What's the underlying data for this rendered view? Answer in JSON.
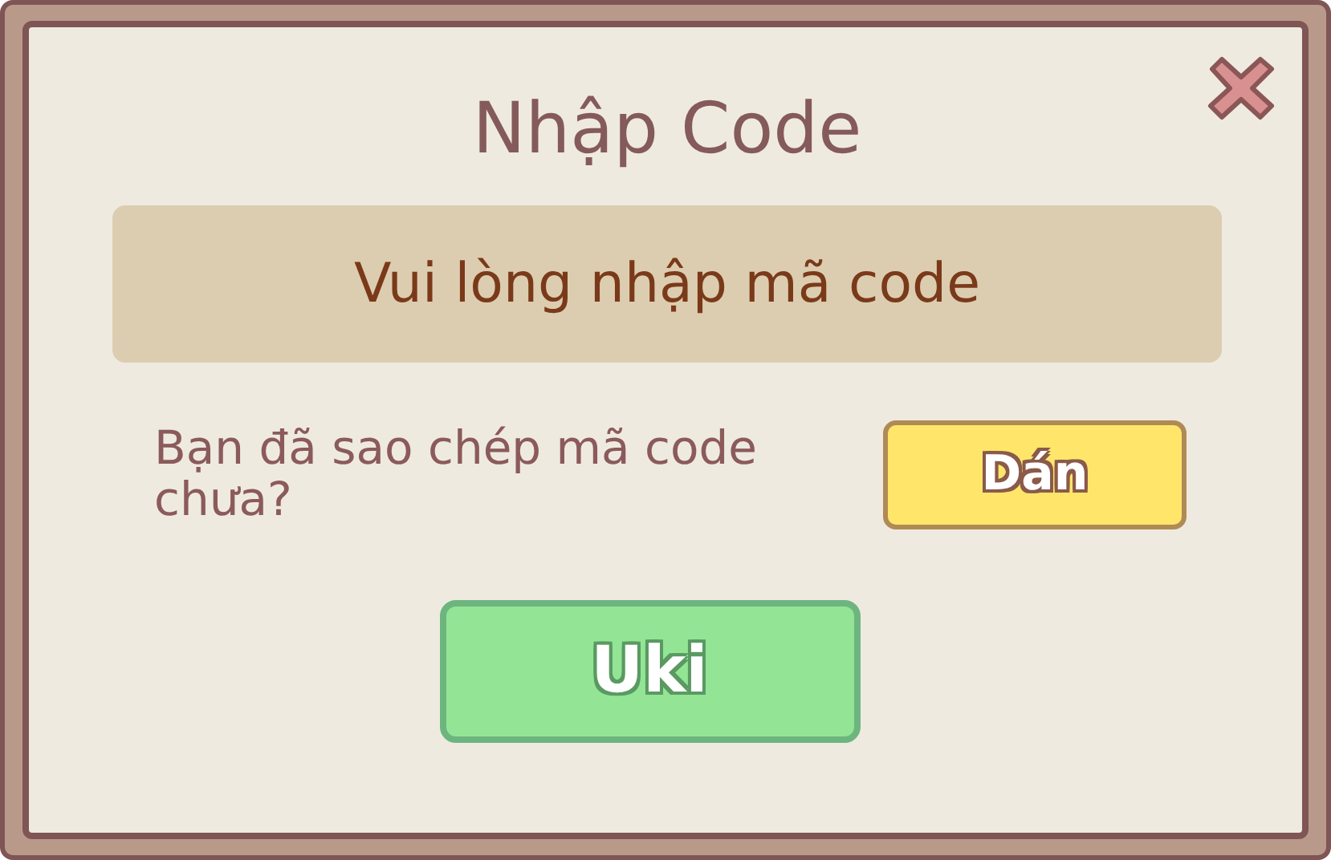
{
  "dialog": {
    "title": "Nhập Code"
  },
  "code_field": {
    "placeholder": "Vui lòng nhập mã code"
  },
  "paste_prompt": "Bạn đã sao chép mã code chưa?",
  "paste_button": "Dán",
  "confirm_button": "Uki"
}
